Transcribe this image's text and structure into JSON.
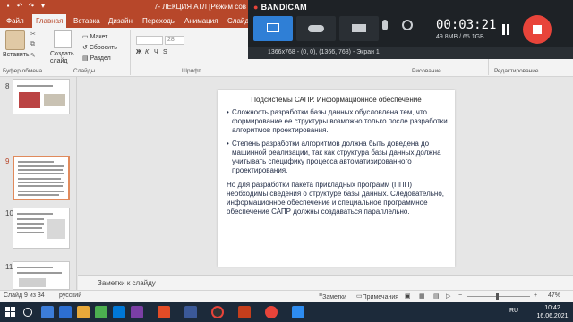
{
  "window": {
    "title": "7- ЛЕКЦИЯ АТЛ [Режим сов",
    "brand_color": "#b7472a"
  },
  "ribbon_tabs": [
    {
      "label": "Файл"
    },
    {
      "label": "Главная"
    },
    {
      "label": "Вставка"
    },
    {
      "label": "Дизайн"
    },
    {
      "label": "Переходы"
    },
    {
      "label": "Анимация"
    },
    {
      "label": "Слайд-"
    }
  ],
  "ribbon": {
    "paste_label": "Вставить",
    "cut_label": "Вырезать",
    "copy_label": "Копировать",
    "format_label": "Формат",
    "create_slide_label": "Создать слайд",
    "layout_label": "Макет",
    "reset_label": "Сбросить",
    "section_label": "Раздел",
    "font_size": "28",
    "groups": {
      "clipboard": "Буфер обмена",
      "slides": "Слайды",
      "shrift": "Шрифт",
      "drawing": "Рисование",
      "editing": "Редактирование"
    }
  },
  "bandicam": {
    "logo": "BANDICAM",
    "timer": "00:03:21",
    "file_size": "49.8MB / 65.1GB",
    "resolution": "1366x768 - (0, 0), (1366, 768) - Экран 1",
    "accent": "#e8443a",
    "modes": [
      "screen-mode-icon",
      "game-mode-icon",
      "hdmi-mode-icon"
    ]
  },
  "thumbnails": [
    {
      "number": "8"
    },
    {
      "number": "9"
    },
    {
      "number": "10"
    },
    {
      "number": "11"
    }
  ],
  "slide": {
    "title": "Подсистемы САПР. Информационное обеспечение",
    "paragraphs": [
      {
        "bullet": "•",
        "text": "Сложность разработки базы данных обусловлена тем, что формирование ее структуры возможно только после разработки алгоритмов проектирования."
      },
      {
        "bullet": "•",
        "text": "Степень разработки алгоритмов должна быть доведена до машинной реализации, так как структура базы данных должна учитывать специфику процесса автоматизированного проектирования."
      },
      {
        "bullet": "",
        "text": "Но для разработки пакета прикладных программ (ППП) необходимы сведения о структуре базы данных. Следовательно, информационное обеспечение и специальное программное обеспечение САПР должны создаваться параллельно."
      }
    ]
  },
  "notes": {
    "placeholder": "Заметки к слайду"
  },
  "status": {
    "slide_counter": "Слайд 9 из 34",
    "language": "русский",
    "notes_label": "Заметки",
    "comments_label": "Примечания",
    "zoom": "47%"
  },
  "taskbar": {
    "lang": "RU",
    "time": "10:42",
    "date": "16.06.2021"
  }
}
